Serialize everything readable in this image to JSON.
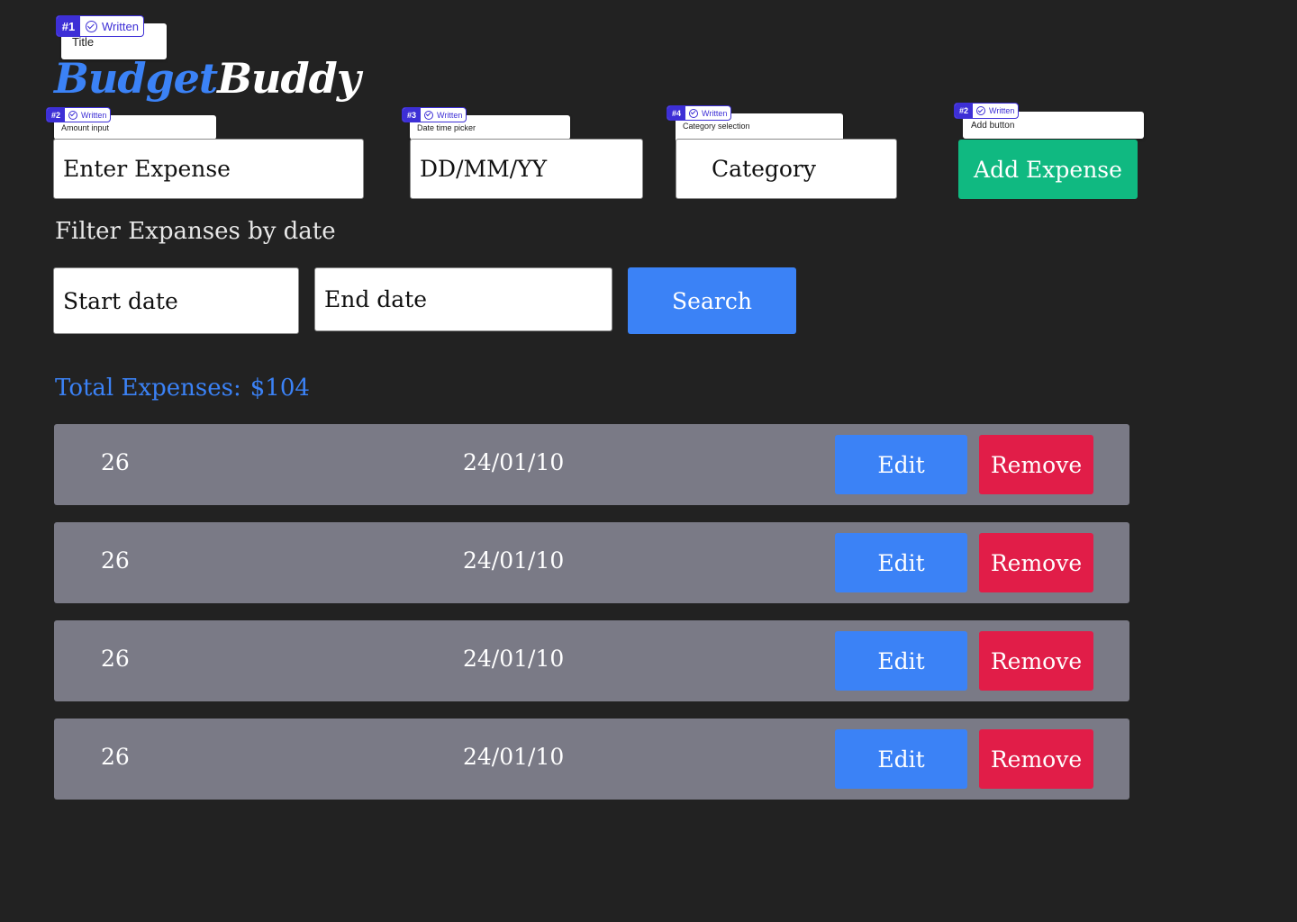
{
  "header": {
    "logo_part1": "Budget",
    "logo_part2": "Buddy"
  },
  "annotations": {
    "title": {
      "num": "#1",
      "status": "Written",
      "label": "Title"
    },
    "amount": {
      "num": "#2",
      "status": "Written",
      "label": "Amount input"
    },
    "date": {
      "num": "#3",
      "status": "Written",
      "label": "Date time picker"
    },
    "category": {
      "num": "#4",
      "status": "Written",
      "label": "Category selection"
    },
    "add": {
      "num": "#2",
      "status": "Written",
      "label": "Add button"
    }
  },
  "form": {
    "amount_placeholder": "Enter Expense",
    "date_placeholder": "DD/MM/YY",
    "category_placeholder": "Category",
    "add_label": "Add Expense"
  },
  "filter": {
    "label": "Filter Expanses by date",
    "start_placeholder": "Start date",
    "end_placeholder": "End date",
    "search_label": "Search"
  },
  "summary": {
    "label": "Total Expenses:",
    "value": "$104"
  },
  "expenses": [
    {
      "amount": "26",
      "date": "24/01/10",
      "edit_label": "Edit",
      "remove_label": "Remove"
    },
    {
      "amount": "26",
      "date": "24/01/10",
      "edit_label": "Edit",
      "remove_label": "Remove"
    },
    {
      "amount": "26",
      "date": "24/01/10",
      "edit_label": "Edit",
      "remove_label": "Remove"
    },
    {
      "amount": "26",
      "date": "24/01/10",
      "edit_label": "Edit",
      "remove_label": "Remove"
    }
  ],
  "colors": {
    "background": "#222222",
    "accent_blue": "#3b82f6",
    "add_green": "#10b981",
    "remove_red": "#e11d48",
    "row_gray": "#7a7a86",
    "annotation_purple": "#3d2fd6"
  }
}
